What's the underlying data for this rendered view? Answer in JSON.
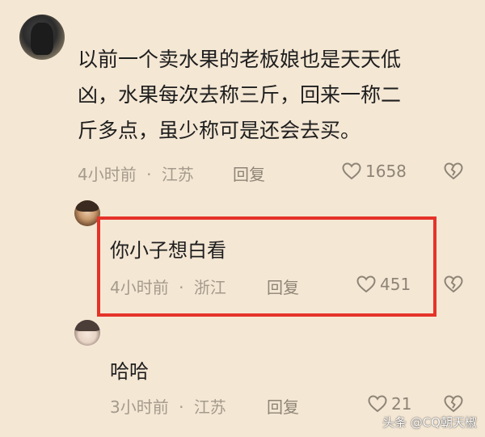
{
  "comments": [
    {
      "text_lines": [
        "以前一个卖水果的老板娘也是天天低",
        "凶，水果每次去称三斤，回来一称二",
        "斤多点，虽少称可是还会去买。"
      ],
      "time": "4小时前",
      "separator": "·",
      "location": "江苏",
      "reply_label": "回复",
      "likes": "1658"
    }
  ],
  "replies": [
    {
      "text": "你小子想白看",
      "time": "4小时前",
      "separator": "·",
      "location": "浙江",
      "reply_label": "回复",
      "likes": "451"
    },
    {
      "text": "哈哈",
      "time": "3小时前",
      "separator": "·",
      "location": "江苏",
      "reply_label": "回复",
      "likes": "21"
    }
  ],
  "watermark": "头条 @CQ朝天椒",
  "colors": {
    "background": "#f4e7d4",
    "highlight": "#e5332a",
    "meta": "#a49a8c"
  },
  "icons": {
    "like": "heart-outline-icon",
    "dislike": "broken-heart-icon"
  }
}
